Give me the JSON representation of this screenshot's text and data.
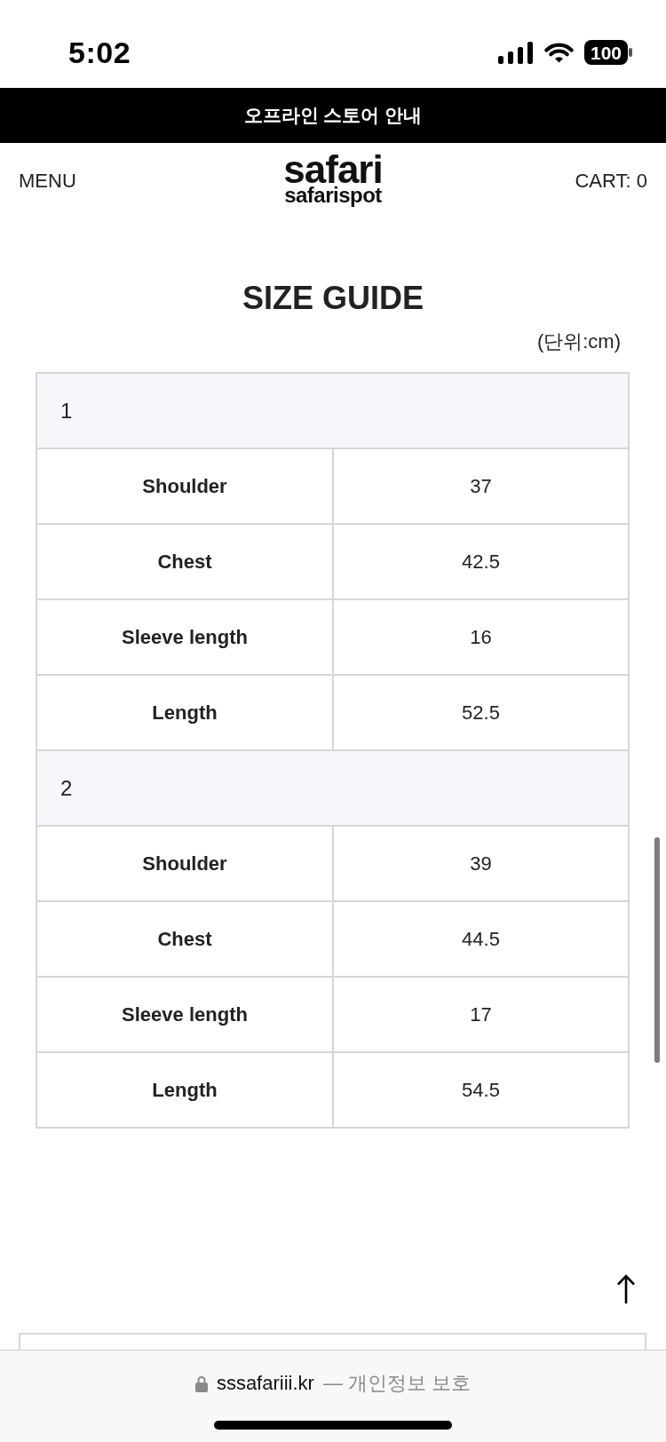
{
  "status_bar": {
    "time": "5:02",
    "battery": "100"
  },
  "announcement_bar": {
    "text": "오프라인 스토어 안내"
  },
  "header": {
    "menu": "MENU",
    "logo": {
      "title": "safari",
      "subtitle": "safarispot"
    },
    "cart": "CART: 0"
  },
  "size_guide": {
    "title": "SIZE GUIDE",
    "unit": "(단위:cm)",
    "groups": [
      {
        "size": "1",
        "rows": [
          {
            "label": "Shoulder",
            "value": "37"
          },
          {
            "label": "Chest",
            "value": "42.5"
          },
          {
            "label": "Sleeve length",
            "value": "16"
          },
          {
            "label": "Length",
            "value": "52.5"
          }
        ]
      },
      {
        "size": "2",
        "rows": [
          {
            "label": "Shoulder",
            "value": "39"
          },
          {
            "label": "Chest",
            "value": "44.5"
          },
          {
            "label": "Sleeve length",
            "value": "17"
          },
          {
            "label": "Length",
            "value": "54.5"
          }
        ]
      }
    ]
  },
  "browser_bar": {
    "domain": "sssafariii.kr",
    "suffix": "— 개인정보 보호"
  }
}
